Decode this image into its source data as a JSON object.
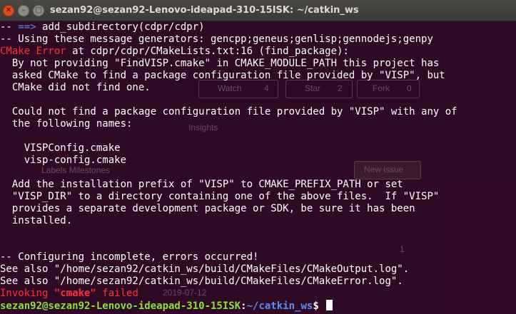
{
  "window": {
    "title": "sezan92@sezan92-Lenovo-ideapad-310-15ISK: ~/catkin_ws",
    "close_glyph": "✕",
    "minimize_glyph": "–",
    "maximize_glyph": "□"
  },
  "background": {
    "watch_label": "Watch",
    "watch_count": "4",
    "star_label": "Star",
    "star_count": "2",
    "fork_label": "Fork",
    "fork_count": "0",
    "insights_label": "Insights",
    "labels_milestones_label": "Labels  Milestones",
    "new_issue_label": "New issue",
    "date_text": "2019-07-12",
    "comment_count": "1"
  },
  "terminal": {
    "colors": {
      "background": "#300a24",
      "text": "#ffffff",
      "error": "#ff3030",
      "prompt_user": "#8ae234",
      "prompt_path": "#5c8ef2"
    },
    "lines": [
      [
        {
          "text": "-- "
        },
        {
          "text": "==>",
          "style": "blue"
        },
        {
          "text": " add_subdirectory(cdpr/cdpr)"
        }
      ],
      [
        {
          "text": "-- Using these message generators: gencpp;geneus;genlisp;gennodejs;genpy"
        }
      ],
      [
        {
          "text": "CMake Error",
          "style": "red"
        },
        {
          "text": " at cdpr/cdpr/CMakeLists.txt:16 (find_package):"
        }
      ],
      [
        {
          "text": "  By not providing \"FindVISP.cmake\" in CMAKE_MODULE_PATH this project has"
        }
      ],
      [
        {
          "text": "  asked CMake to find a package configuration file provided by \"VISP\", but"
        }
      ],
      [
        {
          "text": "  CMake did not find one."
        }
      ],
      [
        {
          "text": ""
        }
      ],
      [
        {
          "text": "  Could not find a package configuration file provided by \"VISP\" with any of"
        }
      ],
      [
        {
          "text": "  the following names:"
        }
      ],
      [
        {
          "text": ""
        }
      ],
      [
        {
          "text": "    VISPConfig.cmake"
        }
      ],
      [
        {
          "text": "    visp-config.cmake"
        }
      ],
      [
        {
          "text": ""
        }
      ],
      [
        {
          "text": "  Add the installation prefix of \"VISP\" to CMAKE_PREFIX_PATH or set"
        }
      ],
      [
        {
          "text": "  \"VISP_DIR\" to a directory containing one of the above files.  If \"VISP\""
        }
      ],
      [
        {
          "text": "  provides a separate development package or SDK, be sure it has been"
        }
      ],
      [
        {
          "text": "  installed."
        }
      ],
      [
        {
          "text": ""
        }
      ],
      [
        {
          "text": ""
        }
      ],
      [
        {
          "text": "-- Configuring incomplete, errors occurred!"
        }
      ],
      [
        {
          "text": "See also \"/home/sezan92/catkin_ws/build/CMakeFiles/CMakeOutput.log\"."
        }
      ],
      [
        {
          "text": "See also \"/home/sezan92/catkin_ws/build/CMakeFiles/CMakeError.log\"."
        }
      ],
      [
        {
          "text": "Invoking ",
          "style": "red"
        },
        {
          "text": "\"cmake\"",
          "style": "red bold"
        },
        {
          "text": " failed",
          "style": "red"
        }
      ]
    ],
    "prompt": {
      "user_host": "sezan92@sezan92-Lenovo-ideapad-310-15ISK",
      "separator": ":",
      "path": "~/catkin_ws",
      "symbol": "$ "
    }
  }
}
